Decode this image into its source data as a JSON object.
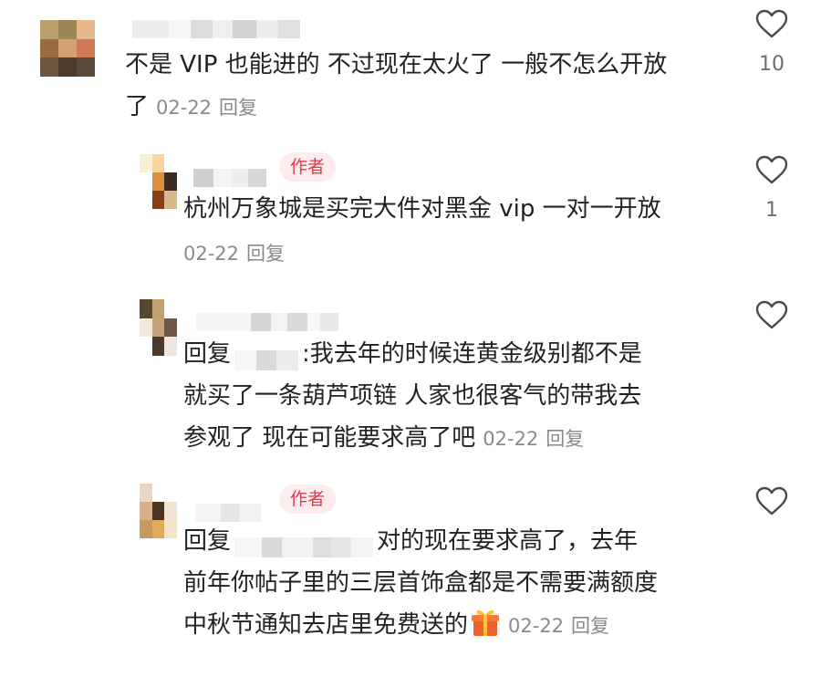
{
  "comments": [
    {
      "text_a": "不是 VIP 也能进的 不过现在太火了 一般不怎么开放",
      "text_b": "了",
      "date": "02-22",
      "reply_label": "回复",
      "like_count": "10"
    },
    {
      "author_badge": "作者",
      "text": "杭州万象城是买完大件对黑金 vip 一对一开放",
      "date": "02-22",
      "reply_label": "回复",
      "like_count": "1"
    },
    {
      "reply_prefix": "回复",
      "after_mention": ":我去年的时候连黄金级别都不是",
      "line2": "就买了一条葫芦项链 人家也很客气的带我去",
      "line3": "参观了 现在可能要求高了吧",
      "date": "02-22",
      "reply_label": "回复"
    },
    {
      "author_badge": "作者",
      "reply_prefix": "回复",
      "after_mention": "对的现在要求高了，去年",
      "line2": "前年你帖子里的三层首饰盒都是不需要满额度",
      "line3": "中秋节通知去店里免费送的",
      "date": "02-22",
      "reply_label": "回复"
    }
  ],
  "icons": {
    "like": "heart-outline-icon",
    "gift": "gift-box-icon"
  },
  "colors": {
    "author_badge_bg": "#fdeced",
    "author_badge_text": "#e23b4a",
    "meta_text": "#8a8a8a"
  }
}
